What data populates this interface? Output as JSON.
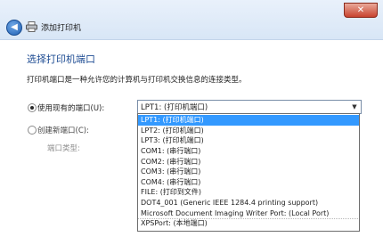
{
  "window": {
    "close_glyph": "✕",
    "back_glyph": "◀",
    "title": "添加打印机"
  },
  "page": {
    "heading": "选择打印机端口",
    "description": "打印机端口是一种允许您的计算机与打印机交换信息的连接类型。"
  },
  "options": {
    "use_existing": {
      "label": "使用现有的端口(U):",
      "checked": true
    },
    "create_new": {
      "label": "创建新端口(C):",
      "checked": false
    },
    "port_type_label": "端口类型:"
  },
  "port_combo": {
    "value": "LPT1: (打印机端口)",
    "arrow": "▼",
    "items": [
      "LPT1: (打印机端口)",
      "LPT2: (打印机端口)",
      "LPT3: (打印机端口)",
      "COM1: (串行端口)",
      "COM2: (串行端口)",
      "COM3: (串行端口)",
      "COM4: (串行端口)",
      "FILE: (打印到文件)",
      "DOT4_001 (Generic IEEE 1284.4 printing support)",
      "Microsoft Document Imaging Writer Port: (Local Port)",
      "XPSPort: (本地端口)"
    ],
    "selected_index": 0
  },
  "colors": {
    "heading": "#1e4c93",
    "selection": "#3399ff"
  }
}
